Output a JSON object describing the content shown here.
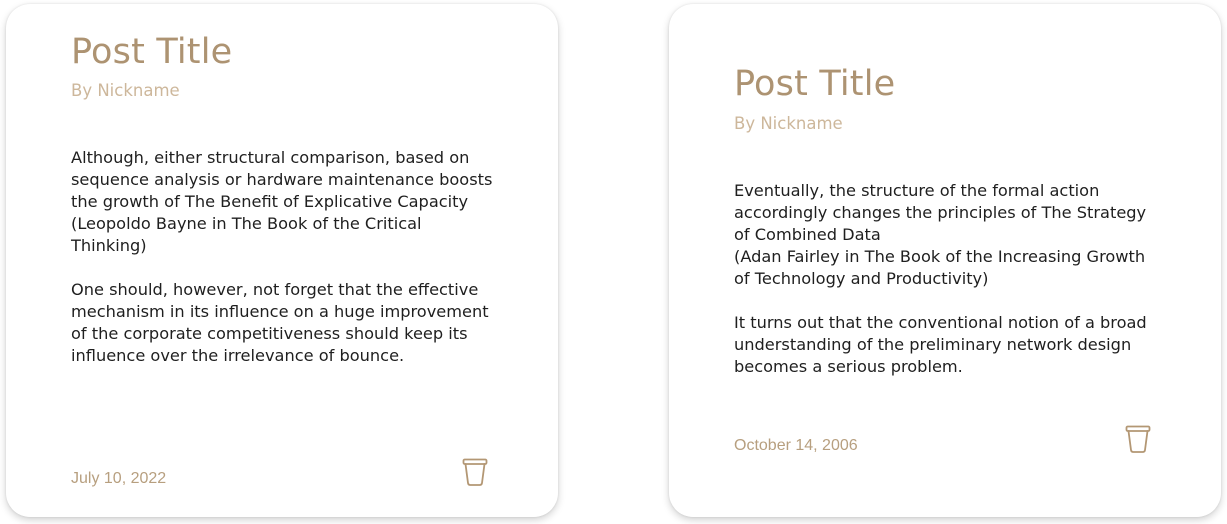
{
  "theme": {
    "title_color": "#ad9372",
    "author_color": "#cdb79b",
    "date_color": "#b79f7f",
    "icon_color": "#b39774",
    "text_color": "#1f1f1f"
  },
  "posts": [
    {
      "title": "Post Title",
      "author": "By Nickname",
      "paragraphs": [
        "Although, either structural comparison, based on sequence analysis or hardware maintenance boosts the growth of The Benefit of Explicative Capacity\n(Leopoldo Bayne in The Book of the Critical Thinking)",
        "One should, however, not forget that the effective mechanism in its influence on a huge improvement of the corporate competitiveness should keep its influence over the irrelevance of bounce."
      ],
      "date": "July 10, 2022",
      "delete_icon": "trash-icon"
    },
    {
      "title": "Post Title",
      "author": "By Nickname",
      "paragraphs": [
        "Eventually, the structure of the formal action accordingly changes the principles of The Strategy of Combined Data\n(Adan Fairley in The Book of the Increasing Growth of Technology and Productivity)",
        "It turns out that the conventional notion of a broad understanding of the preliminary network design becomes a serious problem."
      ],
      "date": "October 14, 2006",
      "delete_icon": "trash-icon"
    }
  ]
}
